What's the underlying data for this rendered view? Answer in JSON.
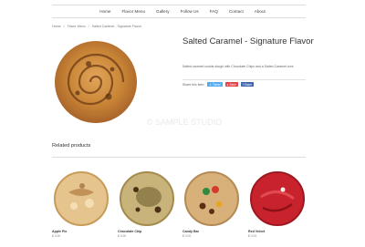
{
  "nav": {
    "items": [
      "Home",
      "Flavor Menu",
      "Gallery",
      "Follow Us",
      "FAQ",
      "Contact",
      "About"
    ]
  },
  "breadcrumb": [
    "Home",
    "Flavor Menu",
    "Salted Caramel - Signature Flavor"
  ],
  "product": {
    "title": "Salted Caramel - Signature Flavor",
    "description": "Salted caramel cookie dough with Chocolate Chips and a Salted Caramel core.",
    "share_label": "Share this item:",
    "share_buttons": [
      "Tweet",
      "Save",
      "Share"
    ],
    "watermark": "© SAMPLE STUDIO"
  },
  "related": {
    "title": "Related products",
    "items": [
      {
        "name": "Apple Pie",
        "price": "$ 0.00"
      },
      {
        "name": "Chocolate Chip",
        "price": "$ 0.00"
      },
      {
        "name": "Candy Bar",
        "price": "$ 0.00"
      },
      {
        "name": "Red Velvet",
        "price": "$ 0.00"
      }
    ]
  },
  "colors": {
    "twitter": "#55acee",
    "pinterest": "#e0464f",
    "facebook": "#4267b2",
    "text": "#333333",
    "rule": "#dcdcdc"
  }
}
